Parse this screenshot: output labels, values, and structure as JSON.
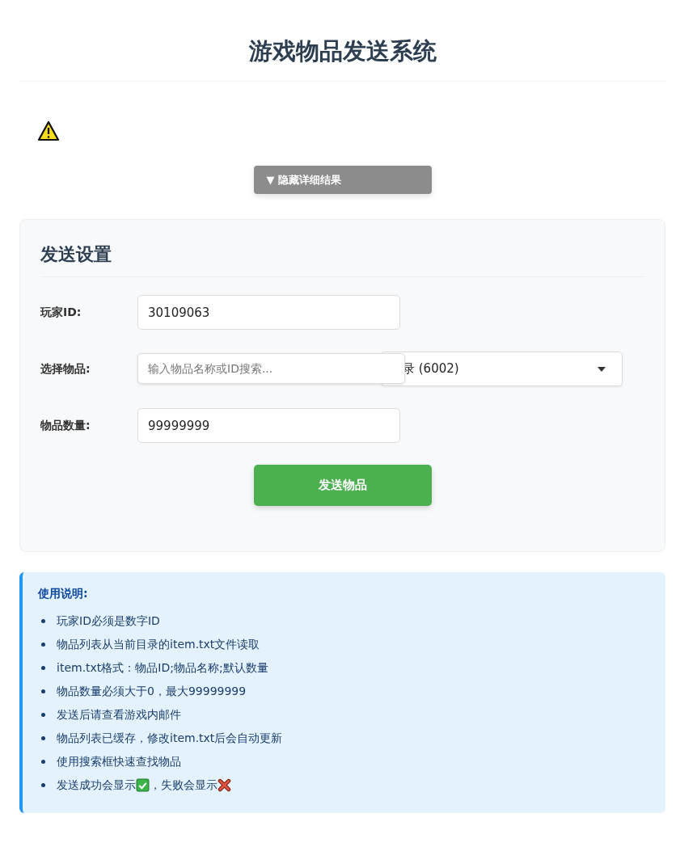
{
  "title": "游戏物品发送系统",
  "alert": {
    "kind": "warning"
  },
  "toggle_button": {
    "arrow": "▼",
    "label": "隐藏详细结果",
    "disabled": true
  },
  "settings": {
    "heading": "发送设置",
    "player_id": {
      "label": "玩家ID:",
      "value": "30109063"
    },
    "item": {
      "label": "选择物品:",
      "placeholder": "输入物品名称或ID搜索...",
      "selected_text": "录 (6002)"
    },
    "quantity": {
      "label": "物品数量:",
      "value": "99999999"
    },
    "send_button": "发送物品"
  },
  "instructions": {
    "heading": "使用说明:",
    "items": [
      [
        {
          "kind": "text",
          "text": "玩家ID必须是数字ID"
        }
      ],
      [
        {
          "kind": "text",
          "text": "物品列表从当前目录的item.txt文件读取"
        }
      ],
      [
        {
          "kind": "text",
          "text": "item.txt格式：物品ID;物品名称;默认数量"
        }
      ],
      [
        {
          "kind": "text",
          "text": "物品数量必须大于0，最大99999999"
        }
      ],
      [
        {
          "kind": "text",
          "text": "发送后请查看游戏内邮件"
        }
      ],
      [
        {
          "kind": "text",
          "text": "物品列表已缓存，修改item.txt后会自动更新"
        }
      ],
      [
        {
          "kind": "text",
          "text": "使用搜索框快速查找物品"
        }
      ],
      [
        {
          "kind": "text",
          "text": "发送成功会显示"
        },
        {
          "kind": "success"
        },
        {
          "kind": "text",
          "text": "，失败会显示"
        },
        {
          "kind": "failure"
        }
      ]
    ]
  }
}
